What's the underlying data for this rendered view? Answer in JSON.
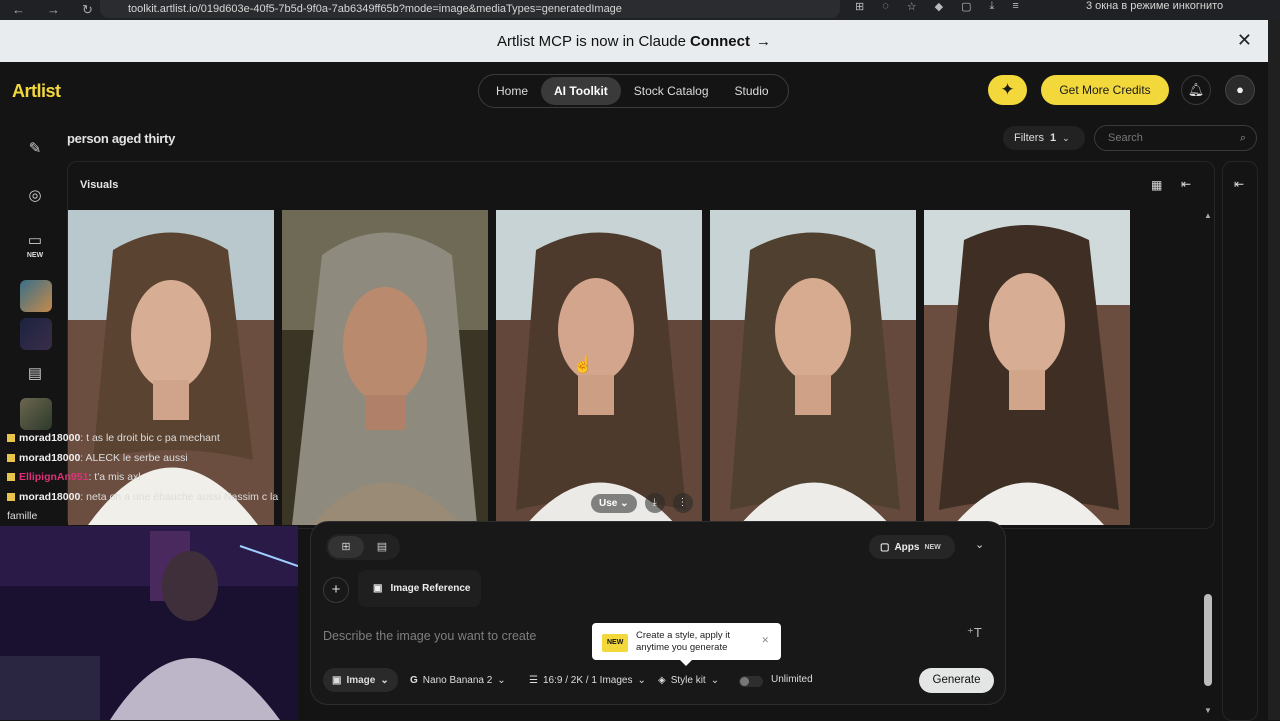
{
  "browser": {
    "url": "toolkit.artlist.io/019d603e-40f5-7b5d-9f0a-7ab6349ff65b?mode=image&mediaTypes=generatedImage",
    "incognito_label": "3 окна в режиме инкогнито"
  },
  "banner": {
    "text": "Artlist MCP is now in Claude",
    "bold": "Connect",
    "arrow": "→"
  },
  "header": {
    "logo": "Artlist",
    "nav": [
      "Home",
      "AI Toolkit",
      "Stock Catalog",
      "Studio"
    ],
    "active_nav": "AI Toolkit",
    "credits_button": "Get More Credits"
  },
  "sidebar": {
    "new_badge": "NEW"
  },
  "search_area": {
    "query": "person aged thirty",
    "filters_label": "Filters",
    "filters_count": "1",
    "search_placeholder": "Search"
  },
  "visuals": {
    "title": "Visuals",
    "use_label": "Use"
  },
  "chat": [
    {
      "user": "morad18000",
      "message": ": t as le droit bic c pa mechant",
      "color": "#f0f0f0"
    },
    {
      "user": "morad18000",
      "message": ": ALECK le serbe aussi",
      "color": "#f0f0f0"
    },
    {
      "user": "EllipignAn951",
      "message": ": t'a mis axl",
      "color": "#e0307a"
    },
    {
      "user": "morad18000",
      "message": ": neta oh a une ébauche aussi Nassim c la",
      "color": "#f0f0f0"
    }
  ],
  "chat_wrap": "famille",
  "composer": {
    "apps_label": "Apps",
    "apps_badge": "NEW",
    "image_reference": "Image Reference",
    "prompt_placeholder": "Describe the image you want to create",
    "tooltip_badge": "NEW",
    "tooltip_text": "Create a style, apply it anytime you generate",
    "mode": "Image",
    "model": "Nano Banana 2",
    "settings": "16:9 / 2K / 1 Images",
    "style": "Style kit",
    "unlimited": "Unlimited",
    "generate": "Generate"
  },
  "colors": {
    "accent": "#f2d83b",
    "background": "#141414",
    "banner": "#e9ecee"
  }
}
